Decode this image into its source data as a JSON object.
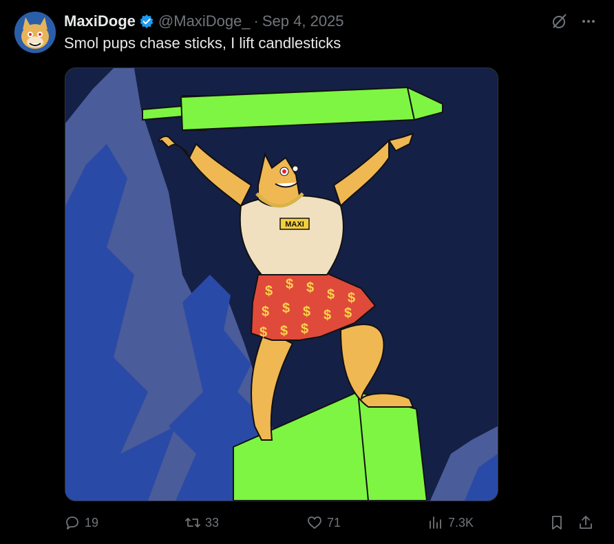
{
  "tweet": {
    "display_name": "MaxiDoge",
    "handle": "@MaxiDoge_",
    "separator": "·",
    "date": "Sep 4, 2025",
    "text": "Smol pups chase sticks, I lift candlesticks",
    "media_label": "MAXI"
  },
  "stats": {
    "replies": "19",
    "retweets": "33",
    "likes": "71",
    "views": "7.3K"
  },
  "icons": {
    "verified": "verified-badge-icon",
    "grok": "grok-icon",
    "more": "more-icon",
    "reply": "reply-icon",
    "retweet": "retweet-icon",
    "like": "heart-icon",
    "views": "views-icon",
    "bookmark": "bookmark-icon",
    "share": "share-icon"
  },
  "colors": {
    "background": "#000000",
    "primary_text": "#e7e9ea",
    "secondary_text": "#71767b",
    "verified": "#1d9bf0",
    "candle_green": "#7ef542",
    "sky": "#152046"
  }
}
